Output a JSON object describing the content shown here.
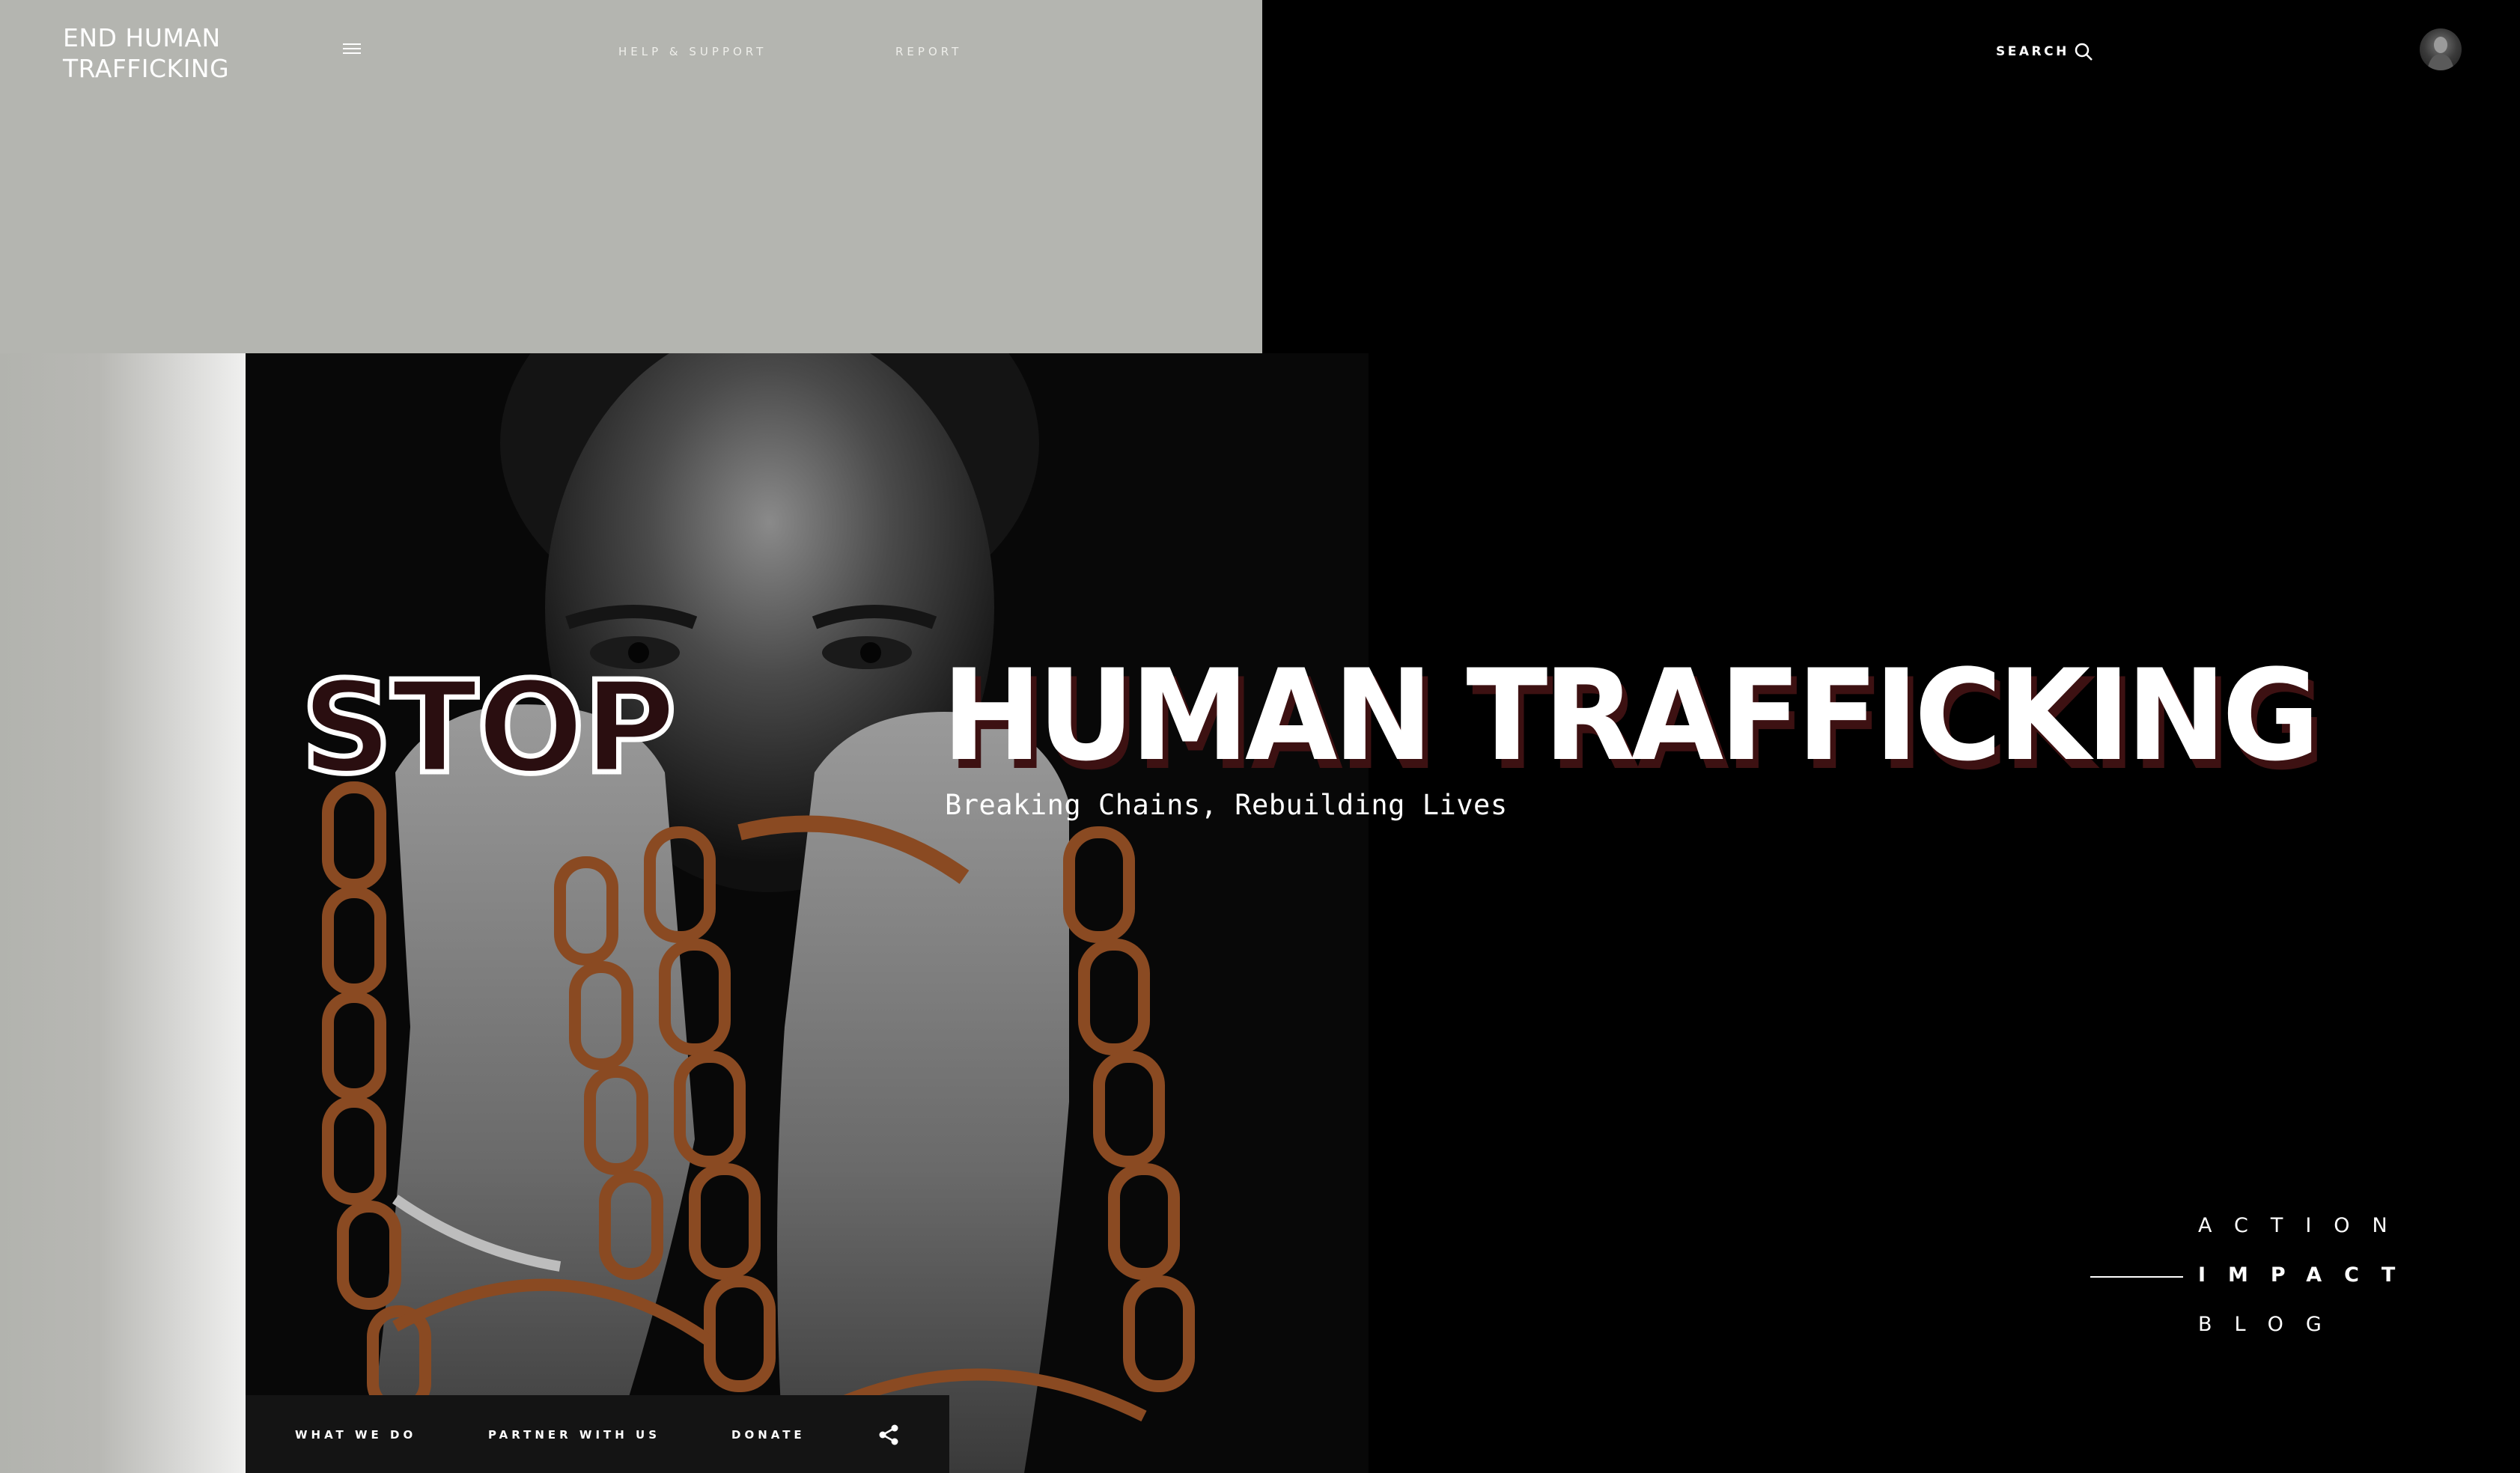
{
  "header": {
    "logo_line1": "END HUMAN",
    "logo_line2": "TRAFFICKING",
    "nav": {
      "help": "HELP & SUPPORT",
      "report": "REPORT"
    },
    "search_label": "SEARCH",
    "menu_icon": "hamburger-icon",
    "search_icon": "search-icon"
  },
  "hero": {
    "stop": "STOP",
    "headline": "HUMAN TRAFFICKING",
    "subtitle": "Breaking Chains, Rebuilding Lives"
  },
  "side_nav": {
    "items": [
      {
        "label": "ACTION"
      },
      {
        "label": "IMPACT",
        "active": true
      },
      {
        "label": "BLOG"
      }
    ]
  },
  "bottom_bar": {
    "what_we_do": "WHAT WE DO",
    "partner": "PARTNER WITH US",
    "donate": "DONATE",
    "share_icon": "share-icon"
  },
  "colors": {
    "grey_panel": "#b4b5b0",
    "background": "#000000",
    "stop_fill": "#2a0e10",
    "headline_shadow": "#3d1112",
    "chain": "#8a4a22"
  }
}
